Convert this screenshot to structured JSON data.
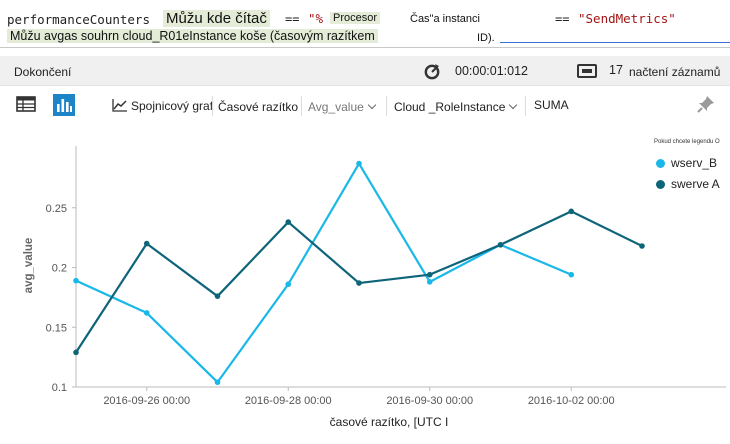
{
  "query": {
    "line1": {
      "table": "performanceCounters",
      "hint": "Můžu kde čítač",
      "op1": "==",
      "pct": "\"%",
      "word": "Procesor",
      "hint2": "Čas\"a instanci",
      "op2": "==",
      "metric": "\"SendMetrics\""
    },
    "line2": {
      "text": "Můžu avgas souhrn cloud_R01eInstance koše (časovým razítkem",
      "tail": "ID)."
    }
  },
  "status": {
    "state": "Dokončení",
    "elapsed": "00:00:01:012",
    "record_count": "17",
    "record_label": "načtení záznamů"
  },
  "toolbar": {
    "chart_type": "Spojnicový graf",
    "x_field": "Časové razítko",
    "y_field": "Avg_value",
    "split_field": "Cloud _RoleInstance",
    "agg": "SUMA"
  },
  "colors": {
    "series_a": "#1ab8e8",
    "series_b": "#0e6479",
    "accent": "#1e84c8"
  },
  "icons": {
    "table_view": "table-icon",
    "chart_view": "bar-chart-icon",
    "line_chart": "line-chart-icon",
    "timer": "timer-icon",
    "records": "records-icon",
    "pin": "pin-icon"
  },
  "chart_data": {
    "type": "line",
    "xlabel": "časové razítko, [UTC I",
    "ylabel": "avg_value",
    "legend_note": "Pokud chcete legendu O",
    "legend_position": "top-right",
    "grid": false,
    "x_ticks": [
      "2016-09-26 00:00",
      "2016-09-28 00:00",
      "2016-09-30 00:00",
      "2016-10-02 00:00"
    ],
    "y_ticks": [
      "0.1",
      "0.15",
      "0.2",
      "0.25"
    ],
    "x": [
      "2016-09-25",
      "2016-09-26",
      "2016-09-27",
      "2016-09-28",
      "2016-09-29",
      "2016-09-30",
      "2016-10-01",
      "2016-10-02",
      "2016-10-03"
    ],
    "xlim": [
      "2016-09-25",
      "2016-10-03"
    ],
    "ylim": [
      0.1,
      0.3
    ],
    "series": [
      {
        "name": "wserv_B",
        "color": "#1ab8e8",
        "values": [
          0.189,
          0.162,
          0.104,
          0.186,
          0.287,
          0.188,
          0.219,
          0.194,
          null
        ]
      },
      {
        "name": "swerve A",
        "color": "#0e6479",
        "values": [
          0.129,
          0.22,
          0.176,
          0.238,
          0.187,
          0.194,
          0.219,
          0.247,
          0.218
        ]
      }
    ]
  }
}
